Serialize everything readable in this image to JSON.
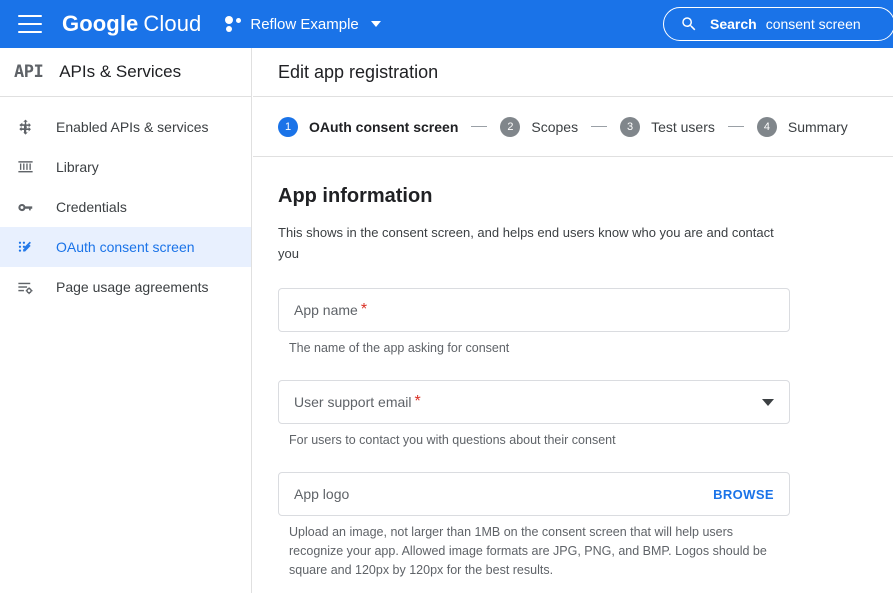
{
  "topbar": {
    "menu_icon": "hamburger-menu-icon",
    "brand_primary": "Google",
    "brand_secondary": "Cloud",
    "project_icon": "project-dots-icon",
    "project_name": "Reflow Example",
    "project_caret_icon": "chevron-down-icon",
    "search_icon": "search-icon",
    "search_label": "Search",
    "search_query": "consent screen",
    "search_placeholder": "Search"
  },
  "sidebar": {
    "logo_text": "API",
    "title": "APIs & Services",
    "items": [
      {
        "label": "Enabled APIs & services",
        "icon": "compass-arrows-icon",
        "selected": false
      },
      {
        "label": "Library",
        "icon": "library-columns-icon",
        "selected": false
      },
      {
        "label": "Credentials",
        "icon": "key-icon",
        "selected": false
      },
      {
        "label": "OAuth consent screen",
        "icon": "consent-pencil-icon",
        "selected": true
      },
      {
        "label": "Page usage agreements",
        "icon": "list-gear-icon",
        "selected": false
      }
    ]
  },
  "main": {
    "page_title": "Edit app registration",
    "stepper": [
      {
        "number": "1",
        "label": "OAuth consent screen",
        "active": true
      },
      {
        "number": "2",
        "label": "Scopes",
        "active": false
      },
      {
        "number": "3",
        "label": "Test users",
        "active": false
      },
      {
        "number": "4",
        "label": "Summary",
        "active": false
      }
    ],
    "section_title": "App information",
    "section_desc": "This shows in the consent screen, and helps end users know who you are and contact you",
    "fields": {
      "app_name": {
        "placeholder": "App name",
        "required_marker": "*",
        "value": "",
        "help": "The name of the app asking for consent"
      },
      "user_support_email": {
        "placeholder": "User support email",
        "required_marker": "*",
        "value": "",
        "help": "For users to contact you with questions about their consent",
        "caret_icon": "chevron-down-icon"
      },
      "app_logo": {
        "placeholder": "App logo",
        "value": "",
        "browse_label": "BROWSE",
        "help": "Upload an image, not larger than 1MB on the consent screen that will help users recognize your app. Allowed image formats are JPG, PNG, and BMP. Logos should be square and 120px by 120px for the best results."
      }
    }
  },
  "colors": {
    "brand_blue": "#1a73e8",
    "selected_bg": "#e8f0fe",
    "required_red": "#d93025",
    "inactive_step": "#80868b",
    "border": "#dadce0",
    "text_primary": "#202124",
    "text_secondary": "#5f6368"
  }
}
